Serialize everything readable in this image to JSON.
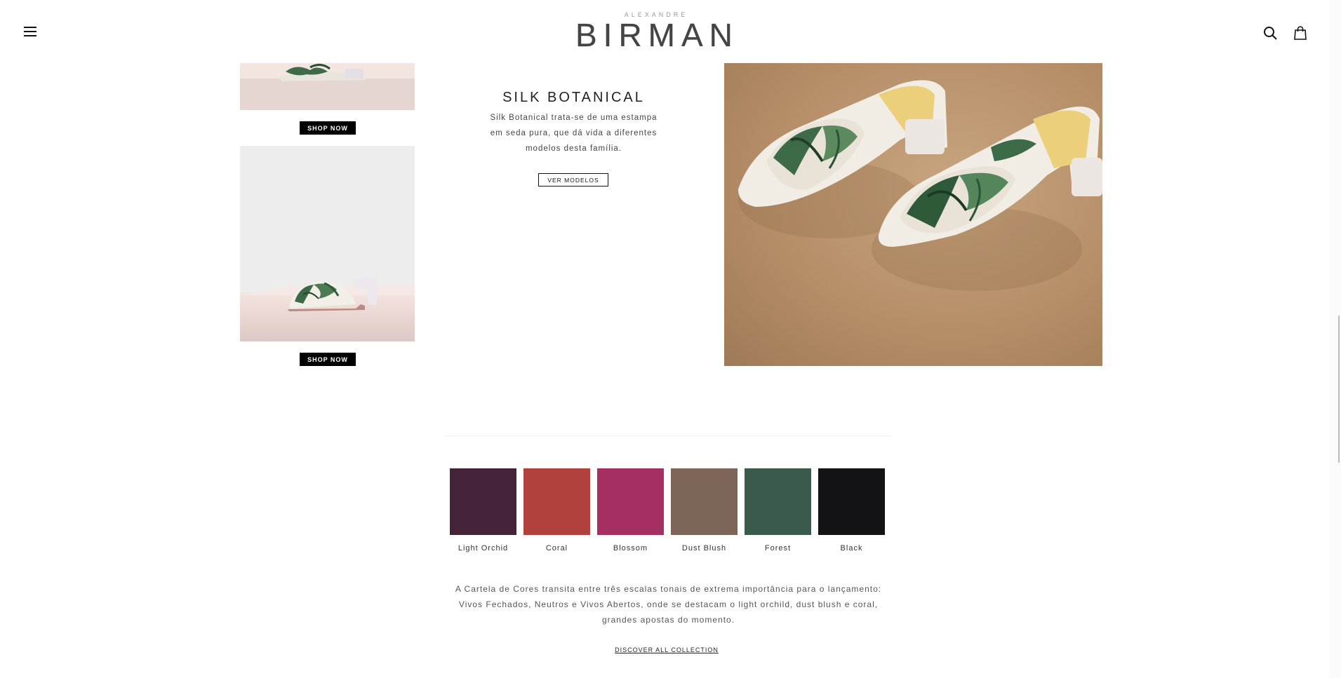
{
  "header": {
    "logo_small": "ALEXANDRE",
    "logo_big": "BIRMAN",
    "menu_icon": "hamburger-menu-icon",
    "search_icon": "search-icon",
    "bag_icon": "shopping-bag-icon"
  },
  "products": {
    "shop_label_top": "SHOP NOW",
    "shop_label_bottom": "SHOP NOW"
  },
  "collection": {
    "title": "SILK BOTANICAL",
    "description": "Silk Botanical trata-se de uma estampa em seda pura, que dá vida a diferentes modelos desta família.",
    "button_label": "VER MODELOS"
  },
  "palette": {
    "swatches": [
      {
        "name": "Light Orchid",
        "color": "#45243a"
      },
      {
        "name": "Coral",
        "color": "#b1413d"
      },
      {
        "name": "Blossom",
        "color": "#a62f61"
      },
      {
        "name": "Dust Blush",
        "color": "#7d6558"
      },
      {
        "name": "Forest",
        "color": "#3a5a4c"
      },
      {
        "name": "Black",
        "color": "#131315"
      }
    ],
    "description": "A Cartela de Cores transita entre três escalas tonais de extrema importância para o lançamento: Vivos Fechados, Neutros e Vivos Abertos, onde se destacam o light orchild, dust blush e coral, grandes apostas do momento.",
    "discover_label": "DISCOVER ALL COLLECTION"
  }
}
